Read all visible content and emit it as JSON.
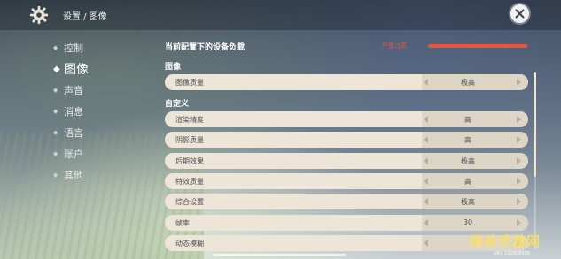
{
  "header": {
    "breadcrumb": "设置 / 图像"
  },
  "sidebar": {
    "items": [
      {
        "label": "控制",
        "active": false
      },
      {
        "label": "图像",
        "active": true
      },
      {
        "label": "声音",
        "active": false
      },
      {
        "label": "消息",
        "active": false
      },
      {
        "label": "语言",
        "active": false
      },
      {
        "label": "账户",
        "active": false
      },
      {
        "label": "其他",
        "active": false
      }
    ]
  },
  "main": {
    "device_load_title": "当前配置下的设备负载",
    "device_load_status": "严重过高",
    "device_load_level": 0.95,
    "image_section": "图像",
    "image_quality": {
      "label": "图像质量",
      "value": "极高"
    },
    "custom_section": "自定义",
    "settings": [
      {
        "label": "渲染精度",
        "value": "高"
      },
      {
        "label": "阴影质量",
        "value": "高"
      },
      {
        "label": "后期效果",
        "value": "极高"
      },
      {
        "label": "特效质量",
        "value": "高"
      },
      {
        "label": "综合设置",
        "value": "极高"
      },
      {
        "label": "帧率",
        "value": "30"
      },
      {
        "label": "动态模糊",
        "value": ""
      }
    ]
  },
  "footer": {
    "uid": "UID: 102808938",
    "watermark": "绿茶手游网"
  },
  "colors": {
    "accent_warning": "#e8553c",
    "row_background": "#ece5d8",
    "row_text": "#4e4f55"
  },
  "icons": {
    "settings": "gear-icon",
    "close": "close-icon"
  }
}
